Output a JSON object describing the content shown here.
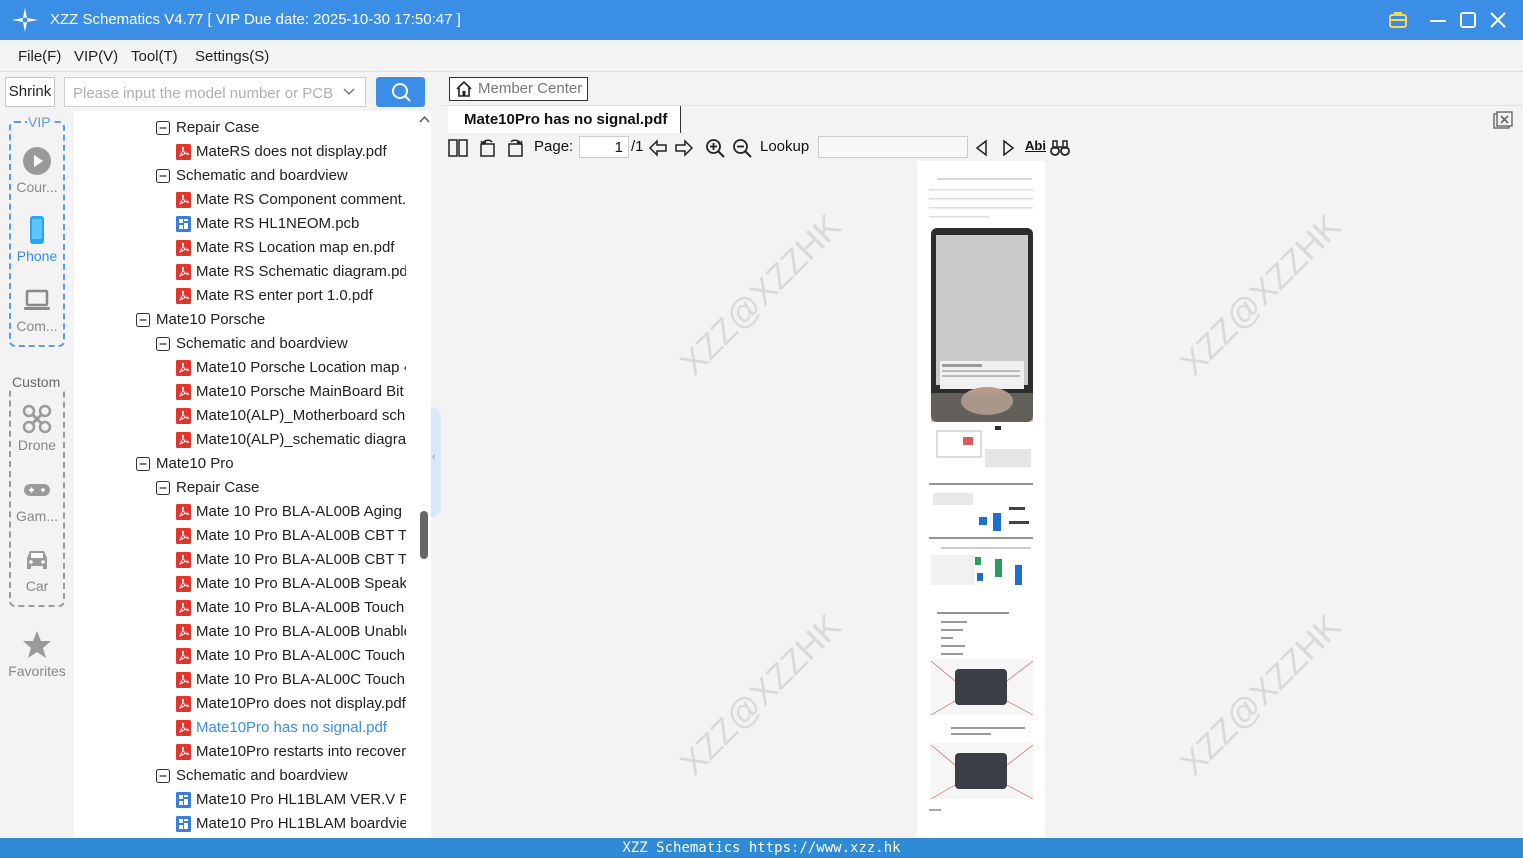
{
  "window": {
    "title": "XZZ Schematics V4.77 [ VIP Due date: 2025-10-30 17:50:47 ]"
  },
  "menu": [
    "File(F)",
    "VIP(V)",
    "Tool(T)",
    "Settings(S)"
  ],
  "search": {
    "shrink_label": "Shrink",
    "placeholder": "Please input the model number or PCB",
    "value": ""
  },
  "categories": {
    "vip_label": "VIP",
    "custom_label": "Custom",
    "vip_items": [
      {
        "label": "Cour...",
        "icon": "play-circle-icon"
      },
      {
        "label": "Phone",
        "icon": "phone-icon"
      },
      {
        "label": "Com...",
        "icon": "laptop-icon"
      }
    ],
    "custom_items": [
      {
        "label": "Drone",
        "icon": "drone-icon"
      },
      {
        "label": "Gam...",
        "icon": "gamepad-icon"
      },
      {
        "label": "Car",
        "icon": "car-icon"
      }
    ],
    "favorites": {
      "label": "Favorites",
      "icon": "star-icon"
    }
  },
  "tree": [
    {
      "text": "Repair Case",
      "kind": "folder",
      "level": 2
    },
    {
      "text": "MateRS does not display.pdf",
      "kind": "pdf",
      "level": 3
    },
    {
      "text": "Schematic and boardview",
      "kind": "folder",
      "level": 2
    },
    {
      "text": "Mate RS Component comment.",
      "kind": "pdf",
      "level": 3
    },
    {
      "text": "Mate RS HL1NEOM.pcb",
      "kind": "pcb",
      "level": 3
    },
    {
      "text": "Mate RS Location map en.pdf",
      "kind": "pdf",
      "level": 3
    },
    {
      "text": "Mate RS Schematic diagram.pd",
      "kind": "pdf",
      "level": 3
    },
    {
      "text": "Mate RS enter port 1.0.pdf",
      "kind": "pdf",
      "level": 3
    },
    {
      "text": "Mate10 Porsche",
      "kind": "folder",
      "level": 1
    },
    {
      "text": "Schematic and boardview",
      "kind": "folder",
      "level": 2
    },
    {
      "text": "Mate10 Porsche Location map ‹",
      "kind": "pdf",
      "level": 3
    },
    {
      "text": "Mate10 Porsche MainBoard Bit",
      "kind": "pdf",
      "level": 3
    },
    {
      "text": "Mate10(ALP)_Motherboard sch‹",
      "kind": "pdf",
      "level": 3
    },
    {
      "text": "Mate10(ALP)_schematic diagrar",
      "kind": "pdf",
      "level": 3
    },
    {
      "text": "Mate10 Pro",
      "kind": "folder",
      "level": 1
    },
    {
      "text": "Repair Case",
      "kind": "folder",
      "level": 2
    },
    {
      "text": "Mate 10 Pro BLA-AL00B Aging ‹",
      "kind": "pdf",
      "level": 3
    },
    {
      "text": "Mate 10 Pro BLA-AL00B CBT Te",
      "kind": "pdf",
      "level": 3
    },
    {
      "text": "Mate 10 Pro BLA-AL00B CBT Te",
      "kind": "pdf",
      "level": 3
    },
    {
      "text": "Mate 10 Pro BLA-AL00B Speake",
      "kind": "pdf",
      "level": 3
    },
    {
      "text": "Mate 10 Pro BLA-AL00B Touch",
      "kind": "pdf",
      "level": 3
    },
    {
      "text": "Mate 10 Pro BLA-AL00B Unable",
      "kind": "pdf",
      "level": 3
    },
    {
      "text": "Mate 10 Pro BLA-AL00C Touch",
      "kind": "pdf",
      "level": 3
    },
    {
      "text": "Mate 10 Pro BLA-AL00C Touch",
      "kind": "pdf",
      "level": 3
    },
    {
      "text": "Mate10Pro does not display.pdf",
      "kind": "pdf",
      "level": 3
    },
    {
      "text": "Mate10Pro has no signal.pdf",
      "kind": "pdf",
      "level": 3,
      "selected": true
    },
    {
      "text": "Mate10Pro restarts into recover",
      "kind": "pdf",
      "level": 3
    },
    {
      "text": "Schematic and boardview",
      "kind": "folder",
      "level": 2
    },
    {
      "text": "Mate10 Pro HL1BLAM VER.V PC",
      "kind": "pcb",
      "level": 3
    },
    {
      "text": "Mate10 Pro HL1BLAM boardvie",
      "kind": "pcb",
      "level": 3
    }
  ],
  "viewer": {
    "member_center": "Member Center",
    "tab_title": "Mate10Pro has no signal.pdf",
    "page_label": "Page:",
    "page_value": "1",
    "page_total": "/1",
    "lookup_label": "Lookup",
    "lookup_value": "",
    "abi_label": "Abi",
    "watermark": "XZZ@XZZHK"
  },
  "status": {
    "text": "XZZ Schematics https://www.xzz.hk"
  },
  "colors": {
    "accent": "#3a8ee6",
    "pdf_red": "#e0352b",
    "pcb_blue": "#3a7fd5"
  }
}
